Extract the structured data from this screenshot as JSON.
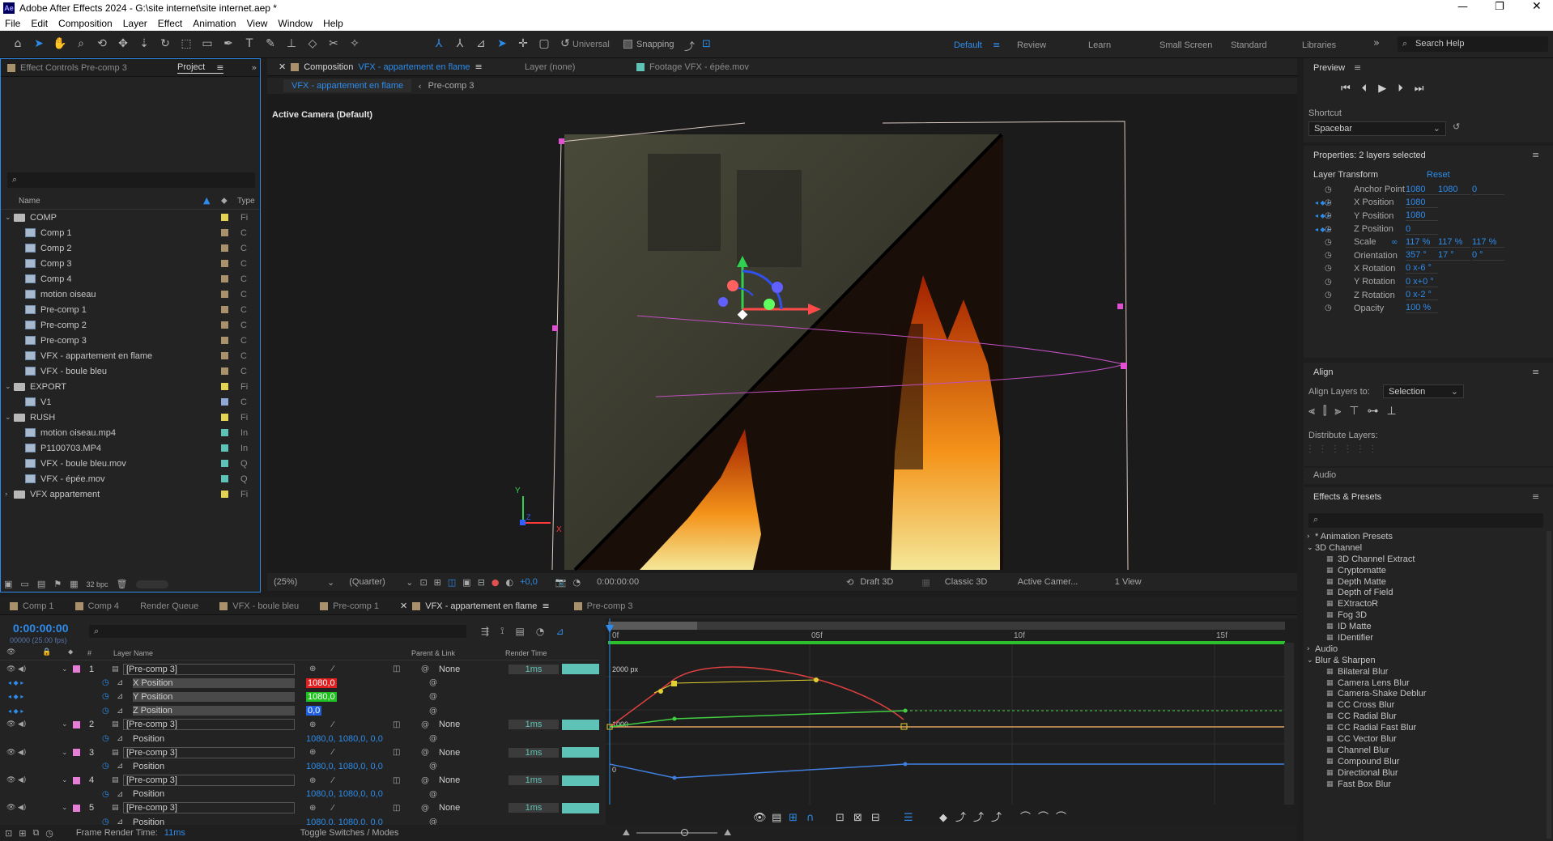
{
  "app": {
    "title": "Adobe After Effects 2024 - G:\\site internet\\site internet.aep *"
  },
  "menu": [
    "File",
    "Edit",
    "Composition",
    "Layer",
    "Effect",
    "Animation",
    "View",
    "Window",
    "Help"
  ],
  "toolbar": {
    "universal": "Universal",
    "snapping": "Snapping",
    "workspaces": [
      "Default",
      "Review",
      "Learn",
      "Small Screen",
      "Standard",
      "Libraries"
    ],
    "search_placeholder": "Search Help"
  },
  "left_panel": {
    "tab_effect_controls": "Effect Controls Pre-comp 3",
    "tab_project": "Project",
    "col_name": "Name",
    "col_type": "Type",
    "bpc": "32 bpc",
    "items": [
      {
        "label": "COMP",
        "kind": "folder",
        "indent": 0,
        "type": "Fi",
        "color": "#e4d252",
        "open": true
      },
      {
        "label": "Comp 1",
        "kind": "comp",
        "indent": 1,
        "type": "C",
        "color": "#a8916b"
      },
      {
        "label": "Comp 2",
        "kind": "comp",
        "indent": 1,
        "type": "C",
        "color": "#a8916b"
      },
      {
        "label": "Comp 3",
        "kind": "comp",
        "indent": 1,
        "type": "C",
        "color": "#a8916b"
      },
      {
        "label": "Comp 4",
        "kind": "comp",
        "indent": 1,
        "type": "C",
        "color": "#a8916b"
      },
      {
        "label": "motion oiseau",
        "kind": "comp",
        "indent": 1,
        "type": "C",
        "color": "#a8916b"
      },
      {
        "label": "Pre-comp 1",
        "kind": "comp",
        "indent": 1,
        "type": "C",
        "color": "#a8916b"
      },
      {
        "label": "Pre-comp 2",
        "kind": "comp",
        "indent": 1,
        "type": "C",
        "color": "#a8916b"
      },
      {
        "label": "Pre-comp 3",
        "kind": "comp",
        "indent": 1,
        "type": "C",
        "color": "#a8916b"
      },
      {
        "label": "VFX - appartement en flame",
        "kind": "comp",
        "indent": 1,
        "type": "C",
        "color": "#a8916b"
      },
      {
        "label": "VFX - boule bleu",
        "kind": "comp",
        "indent": 1,
        "type": "C",
        "color": "#a8916b"
      },
      {
        "label": "EXPORT",
        "kind": "folder",
        "indent": 0,
        "type": "Fi",
        "color": "#e4d252",
        "open": true
      },
      {
        "label": "V1",
        "kind": "file",
        "indent": 1,
        "type": "C",
        "color": "#8fa8d6"
      },
      {
        "label": "RUSH",
        "kind": "folder",
        "indent": 0,
        "type": "Fi",
        "color": "#e4d252",
        "open": true
      },
      {
        "label": "motion oiseau.mp4",
        "kind": "file",
        "indent": 1,
        "type": "In",
        "color": "#5ec3b6"
      },
      {
        "label": "P1100703.MP4",
        "kind": "file",
        "indent": 1,
        "type": "In",
        "color": "#5ec3b6"
      },
      {
        "label": "VFX - boule bleu.mov",
        "kind": "file",
        "indent": 1,
        "type": "Q",
        "color": "#5ec3b6"
      },
      {
        "label": "VFX - épée.mov",
        "kind": "file",
        "indent": 1,
        "type": "Q",
        "color": "#5ec3b6"
      },
      {
        "label": "VFX appartement",
        "kind": "folder",
        "indent": 0,
        "type": "Fi",
        "color": "#e4d252",
        "open": false
      }
    ]
  },
  "viewer": {
    "tab_comp_prefix": "Composition",
    "tab_comp_name": "VFX - appartement en flame",
    "tab_layer": "Layer (none)",
    "tab_footage": "Footage VFX - épée.mov",
    "breadcrumb1": "VFX - appartement en flame",
    "breadcrumb2": "Pre-comp 3",
    "camera_label": "Active Camera (Default)",
    "zoom": "(25%)",
    "quality": "(Quarter)",
    "exposure": "+0,0",
    "timecode": "0:00:00:00",
    "draft": "Draft 3D",
    "renderer": "Classic 3D",
    "view_camera": "Active Camer...",
    "views": "1 View"
  },
  "preview": {
    "title": "Preview",
    "shortcut_label": "Shortcut",
    "shortcut_value": "Spacebar"
  },
  "properties": {
    "title": "Properties: 2 layers selected",
    "section": "Layer Transform",
    "reset": "Reset",
    "rows": [
      {
        "label": "Anchor Point",
        "values": [
          "1080",
          "1080",
          "0"
        ]
      },
      {
        "label": "X Position",
        "values": [
          "1080"
        ]
      },
      {
        "label": "Y Position",
        "values": [
          "1080"
        ]
      },
      {
        "label": "Z Position",
        "values": [
          "0"
        ]
      },
      {
        "label": "Scale",
        "values": [
          "117 %",
          "117 %",
          "117 %"
        ]
      },
      {
        "label": "Orientation",
        "values": [
          "357 °",
          "17 °",
          "0 °"
        ]
      },
      {
        "label": "X Rotation",
        "values": [
          "0 x-6 °"
        ]
      },
      {
        "label": "Y Rotation",
        "values": [
          "0 x+0 °"
        ]
      },
      {
        "label": "Z Rotation",
        "values": [
          "0 x-2 °"
        ]
      },
      {
        "label": "Opacity",
        "values": [
          "100 %"
        ]
      }
    ]
  },
  "align": {
    "title": "Align",
    "align_to_label": "Align Layers to:",
    "align_to_value": "Selection",
    "distribute": "Distribute Layers:"
  },
  "audio": {
    "title": "Audio"
  },
  "effects": {
    "title": "Effects & Presets",
    "items": [
      {
        "label": "* Animation Presets",
        "level": 0,
        "open": false
      },
      {
        "label": "3D Channel",
        "level": 0,
        "open": true
      },
      {
        "label": "3D Channel Extract",
        "level": 1
      },
      {
        "label": "Cryptomatte",
        "level": 1
      },
      {
        "label": "Depth Matte",
        "level": 1
      },
      {
        "label": "Depth of Field",
        "level": 1
      },
      {
        "label": "EXtractoR",
        "level": 1
      },
      {
        "label": "Fog 3D",
        "level": 1
      },
      {
        "label": "ID Matte",
        "level": 1
      },
      {
        "label": "IDentifier",
        "level": 1
      },
      {
        "label": "Audio",
        "level": 0,
        "open": false
      },
      {
        "label": "Blur & Sharpen",
        "level": 0,
        "open": true
      },
      {
        "label": "Bilateral Blur",
        "level": 1
      },
      {
        "label": "Camera Lens Blur",
        "level": 1
      },
      {
        "label": "Camera-Shake Deblur",
        "level": 1
      },
      {
        "label": "CC Cross Blur",
        "level": 1
      },
      {
        "label": "CC Radial Blur",
        "level": 1
      },
      {
        "label": "CC Radial Fast Blur",
        "level": 1
      },
      {
        "label": "CC Vector Blur",
        "level": 1
      },
      {
        "label": "Channel Blur",
        "level": 1
      },
      {
        "label": "Compound Blur",
        "level": 1
      },
      {
        "label": "Directional Blur",
        "level": 1
      },
      {
        "label": "Fast Box Blur",
        "level": 1
      }
    ]
  },
  "timeline": {
    "tabs": [
      "Comp 1",
      "Comp 4",
      "Render Queue",
      "VFX - boule bleu",
      "Pre-comp 1",
      "VFX - appartement en flame",
      "Pre-comp 3"
    ],
    "timecode": "0:00:00:00",
    "fps": "00000 (25.00 fps)",
    "col_layer": "Layer Name",
    "col_parent": "Parent & Link",
    "col_render": "Render Time",
    "ruler": [
      "0f",
      "05f",
      "10f",
      "15f"
    ],
    "graph_top": "2000 px",
    "graph_mid": "1000",
    "graph_zero": "0",
    "layers": [
      {
        "num": "1",
        "name": "[Pre-comp 3]",
        "parent": "None",
        "render": "1ms"
      },
      {
        "num": "2",
        "name": "[Pre-comp 3]",
        "parent": "None",
        "render": "1ms"
      },
      {
        "num": "3",
        "name": "[Pre-comp 3]",
        "parent": "None",
        "render": "1ms"
      },
      {
        "num": "4",
        "name": "[Pre-comp 3]",
        "parent": "None",
        "render": "1ms"
      },
      {
        "num": "5",
        "name": "[Pre-comp 3]",
        "parent": "None",
        "render": "1ms"
      }
    ],
    "sub1": [
      {
        "label": "X Position",
        "value": "1080,0"
      },
      {
        "label": "Y Position",
        "value": "1080,0"
      },
      {
        "label": "Z Position",
        "value": "0,0"
      }
    ],
    "position_label": "Position",
    "position_value": "1080,0, 1080,0, 0,0",
    "frame_render_label": "Frame Render Time:",
    "frame_render_value": "11ms",
    "toggle": "Toggle Switches / Modes"
  }
}
